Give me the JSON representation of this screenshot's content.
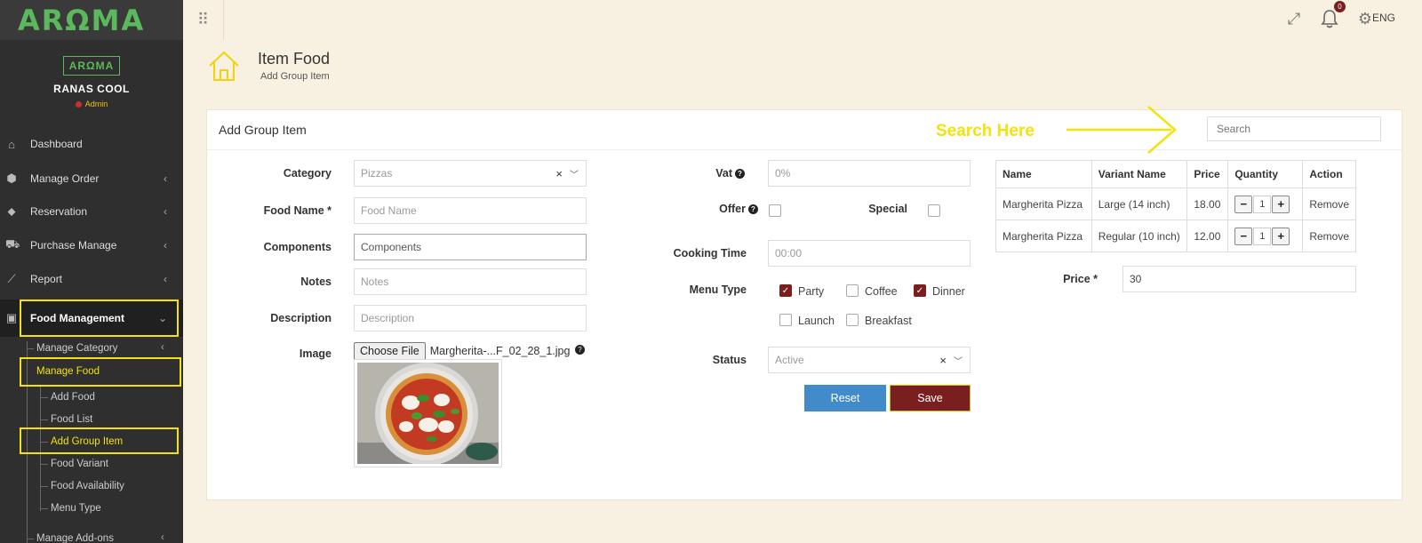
{
  "brand": {
    "logo": "ARΩMA",
    "profile_logo": "ARΩMA",
    "user_name": "RANAS COOL",
    "user_role": "Admin"
  },
  "sidebar": {
    "items": [
      {
        "label": "Dashboard",
        "icon": "home-icon"
      },
      {
        "label": "Manage Order",
        "icon": "hexagon-icon"
      },
      {
        "label": "Reservation",
        "icon": "tag-icon"
      },
      {
        "label": "Purchase Manage",
        "icon": "cart-icon"
      },
      {
        "label": "Report",
        "icon": "chart-line-icon"
      },
      {
        "label": "Food Management",
        "icon": "box-icon"
      }
    ],
    "sub_items": [
      "Manage Category",
      "Manage Food",
      "Add Food",
      "Food List",
      "Add Group Item",
      "Food Variant",
      "Food Availability",
      "Menu Type",
      "Manage Add-ons"
    ]
  },
  "topbar": {
    "notification_count": "0",
    "language": "ENG"
  },
  "page": {
    "title": "Item Food",
    "subtitle": "Add Group Item"
  },
  "card": {
    "title": "Add Group Item",
    "search_note": "Search Here",
    "search_placeholder": "Search"
  },
  "form": {
    "category_label": "Category",
    "category_value": "Pizzas",
    "food_name_label": "Food Name *",
    "food_name_placeholder": "Food Name",
    "components_label": "Components",
    "components_placeholder": "Components",
    "notes_label": "Notes",
    "notes_placeholder": "Notes",
    "description_label": "Description",
    "description_placeholder": "Description",
    "image_label": "Image",
    "choose_file": "Choose File",
    "file_name": "Margherita-...F_02_28_1.jpg",
    "vat_label": "Vat",
    "vat_placeholder": "0%",
    "offer_label": "Offer",
    "special_label": "Special",
    "cooking_time_label": "Cooking Time",
    "cooking_time_placeholder": "00:00",
    "menu_type_label": "Menu Type",
    "menu_types": [
      {
        "label": "Party",
        "checked": true
      },
      {
        "label": "Coffee",
        "checked": false
      },
      {
        "label": "Dinner",
        "checked": true
      },
      {
        "label": "Launch",
        "checked": false
      },
      {
        "label": "Breakfast",
        "checked": false
      }
    ],
    "status_label": "Status",
    "status_value": "Active",
    "reset_label": "Reset",
    "save_label": "Save",
    "price_label": "Price *",
    "price_value": "30"
  },
  "table": {
    "headers": [
      "Name",
      "Variant Name",
      "Price",
      "Quantity",
      "Action"
    ],
    "rows": [
      {
        "name": "Margherita Pizza",
        "variant": "Large (14 inch)",
        "price": "18.00",
        "qty": "1",
        "action": "Remove"
      },
      {
        "name": "Margherita Pizza",
        "variant": "Regular (10 inch)",
        "price": "12.00",
        "qty": "1",
        "action": "Remove"
      }
    ]
  },
  "colors": {
    "sidebar": "#2f2f2f",
    "brand_green": "#5cb85c",
    "highlight": "#f3e20b",
    "save": "#7a1f1f",
    "reset": "#428bca",
    "background": "#f8f1e1"
  }
}
